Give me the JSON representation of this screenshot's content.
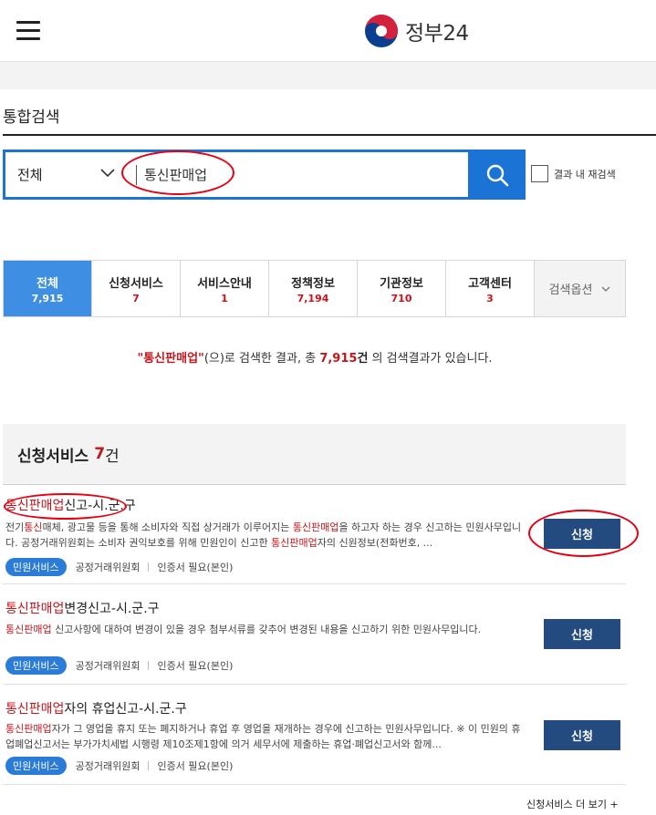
{
  "header": {
    "logo_text": "정부24",
    "menu_icon": "hamburger-menu-icon"
  },
  "page": {
    "title": "통합검색"
  },
  "search": {
    "scope_value": "전체",
    "query": "통신판매업",
    "search_icon": "search-icon",
    "research_label": "결과 내 재검색"
  },
  "tabs": [
    {
      "label": "전체",
      "count": "7,915",
      "active": true
    },
    {
      "label": "신청서비스",
      "count": "7"
    },
    {
      "label": "서비스안내",
      "count": "1"
    },
    {
      "label": "정책정보",
      "count": "7,194"
    },
    {
      "label": "기관정보",
      "count": "710"
    },
    {
      "label": "고객센터",
      "count": "3"
    }
  ],
  "search_options_label": "검색옵션",
  "summary": {
    "keyword": "\"통신판매업\"",
    "text1": "(으)로 검색한 결과, 총 ",
    "count": "7,915",
    "unit": "건",
    "text2": " 의 검색결과가 있습니다."
  },
  "section": {
    "title": "신청서비스",
    "count": "7",
    "unit": "건"
  },
  "results": [
    {
      "title_hl": "통신판매업",
      "title_rest": "신고-시.군.구",
      "desc_parts": [
        "전기",
        "통신",
        "매체, 광고물 등을 통해 소비자와 직접 상거래가 이루어지는 ",
        "통신판매업",
        "을 하고자 하는 경우 신고하는 민원사무입니다. 공정거래위원회는 소비자 권익보호를 위해 민원인이 신고한 ",
        "통신판매업",
        "자의 신원정보(전화번호, ..."
      ],
      "badge": "민원서비스",
      "agency": "공정거래위원회",
      "auth": "인증서 필요(본인)",
      "button": "신청"
    },
    {
      "title_hl": "통신판매업",
      "title_rest": "변경신고-시.군.구",
      "desc_parts": [
        "",
        "통신판매업",
        " 신고사항에 대하여 변경이 있을 경우 첨부서류를 갖추어 변경된 내용을 신고하기 위한 민원사무입니다."
      ],
      "badge": "민원서비스",
      "agency": "공정거래위원회",
      "auth": "인증서 필요(본인)",
      "button": "신청"
    },
    {
      "title_hl": "통신판매업",
      "title_rest": "자의 휴업신고-시.군.구",
      "desc_parts": [
        "",
        "통신판매업",
        "자가 그 영업을 휴지 또는 폐지하거나 휴업 후 영업을 재개하는 경우에 신고하는 민원사무입니다. ※ 이 민원의 휴업폐업신고서는 부가가치세법 시행령 제10조제1항에 의거 세무서에 제출하는 휴업·폐업신고서와 함께..."
      ],
      "badge": "민원서비스",
      "agency": "공정거래위원회",
      "auth": "인증서 필요(본인)",
      "button": "신청"
    }
  ],
  "more_link": "신청서비스 더 보기  +",
  "colors": {
    "accent_blue": "#1c73d6",
    "active_tab": "#3e8fe4",
    "highlight_red": "#c5161d",
    "button_navy": "#244b80",
    "annotation_red": "#e60012"
  }
}
